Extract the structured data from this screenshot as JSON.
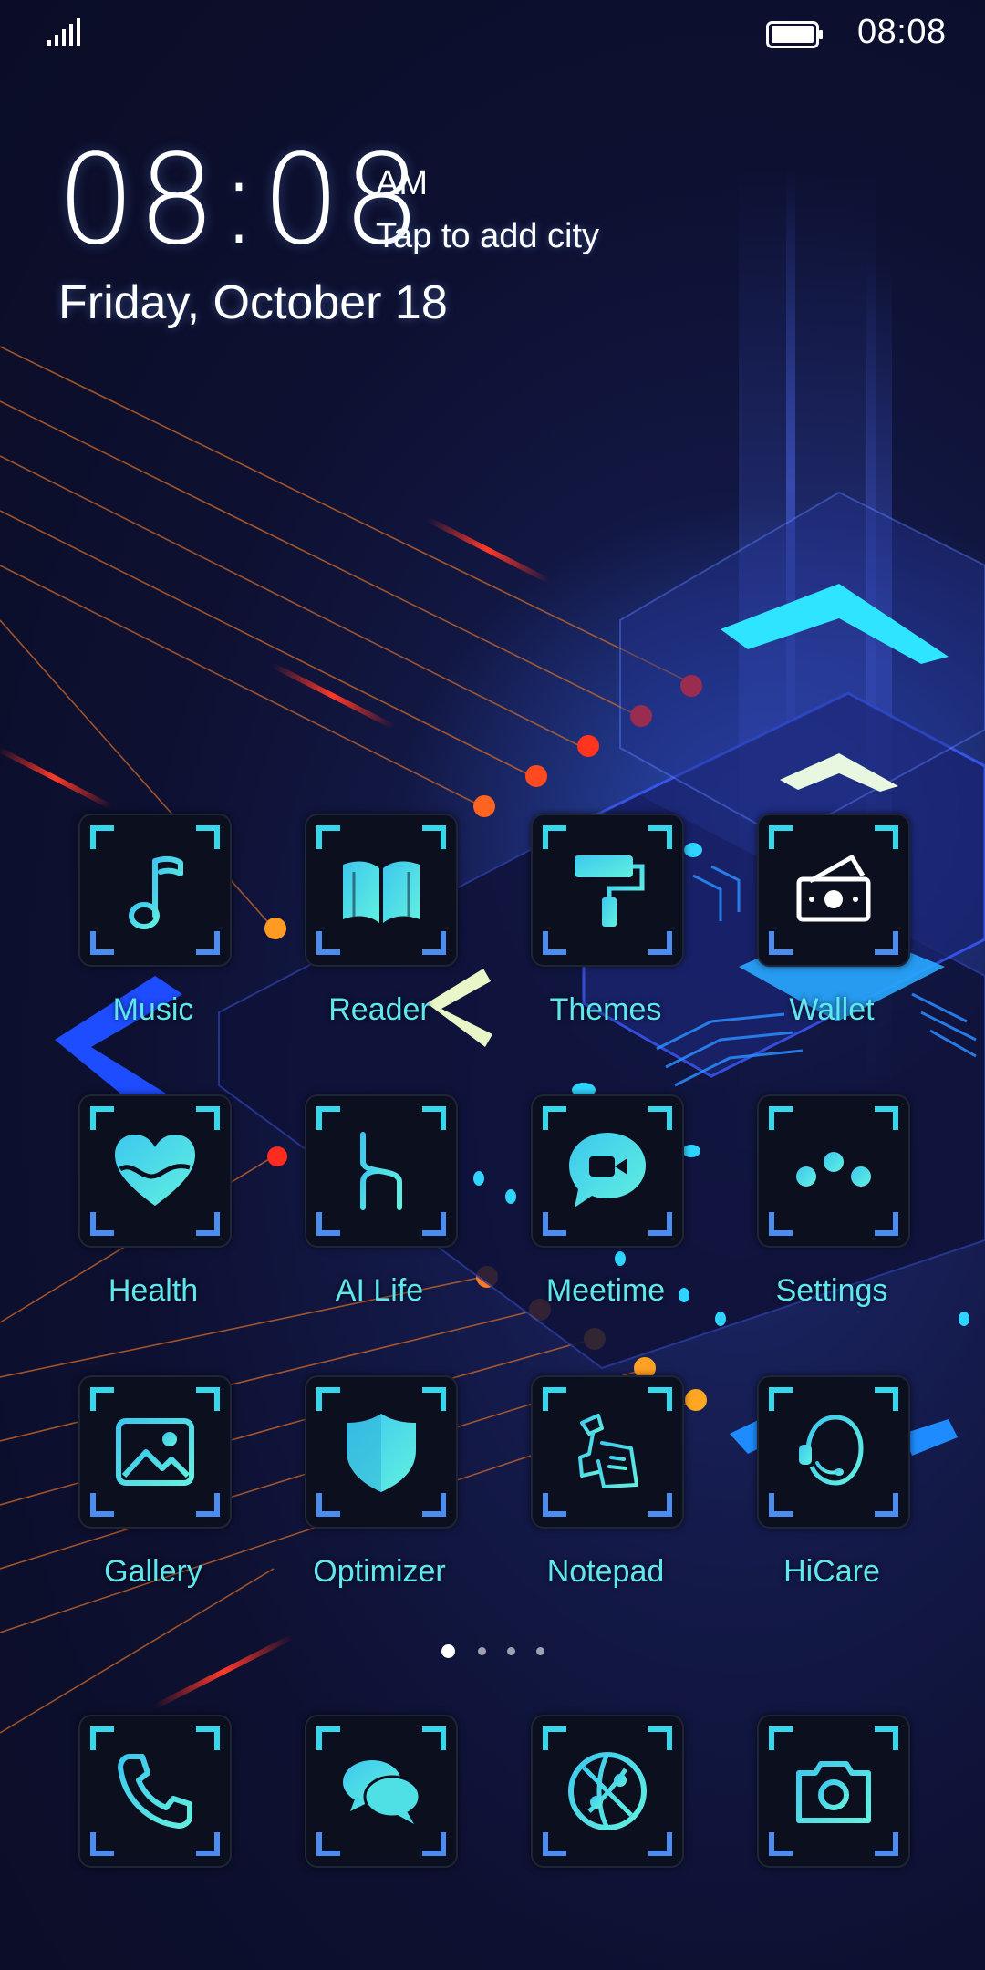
{
  "status_bar": {
    "time": "08:08",
    "signal_icon": "signal-bars-icon",
    "battery_icon": "battery-full-icon"
  },
  "clock_widget": {
    "time": "08:08",
    "ampm": "AM",
    "city_prompt": "Tap to add city",
    "date": "Friday, October 18"
  },
  "apps": [
    {
      "label": "Music",
      "icon": "music-note-icon"
    },
    {
      "label": "Reader",
      "icon": "open-book-icon"
    },
    {
      "label": "Themes",
      "icon": "paint-roller-icon"
    },
    {
      "label": "Wallet",
      "icon": "wallet-cash-icon"
    },
    {
      "label": "Health",
      "icon": "heart-pulse-icon"
    },
    {
      "label": "AI Life",
      "icon": "ai-life-icon"
    },
    {
      "label": "Meetime",
      "icon": "video-chat-icon"
    },
    {
      "label": "Settings",
      "icon": "sliders-icon"
    },
    {
      "label": "Gallery",
      "icon": "image-icon"
    },
    {
      "label": "Optimizer",
      "icon": "shield-icon"
    },
    {
      "label": "Notepad",
      "icon": "notepad-icon"
    },
    {
      "label": "HiCare",
      "icon": "support-headset-icon"
    }
  ],
  "page_indicator": {
    "total_pages": 4,
    "current_page": 1
  },
  "dock": [
    {
      "icon": "phone-icon"
    },
    {
      "icon": "messages-icon"
    },
    {
      "icon": "browser-globe-icon"
    },
    {
      "icon": "camera-icon"
    }
  ],
  "colors": {
    "accent_cyan": "#5fe7ee",
    "icon_gradient_start": "#3cc8ee",
    "icon_gradient_end": "#62f0e0",
    "tile_background": "#0c0f1e",
    "wallpaper_dark": "#0b0d26",
    "wallpaper_blue": "#1d2a6e"
  }
}
